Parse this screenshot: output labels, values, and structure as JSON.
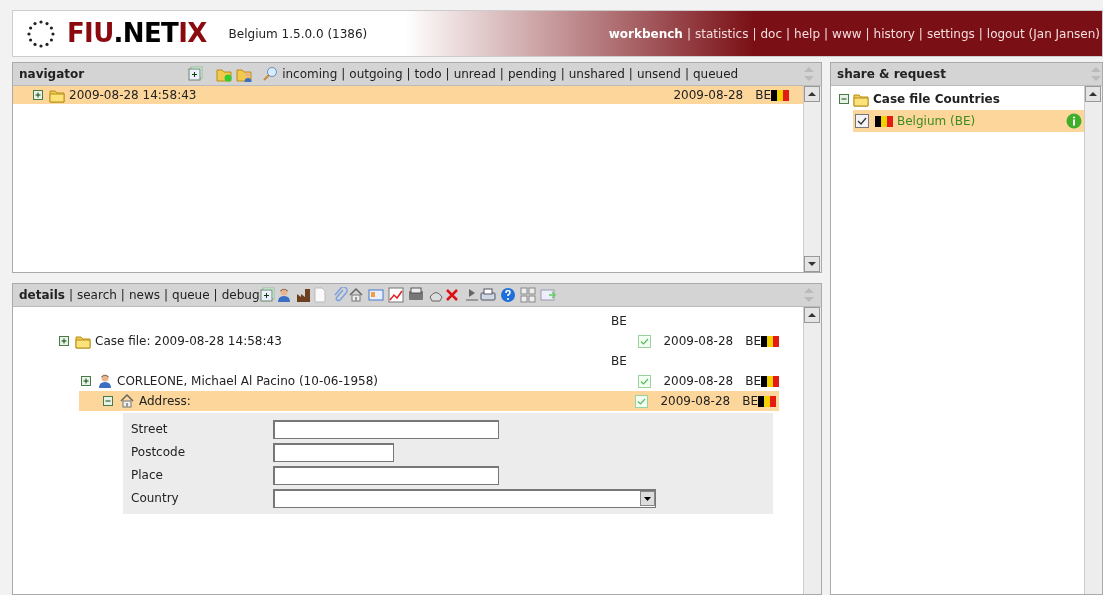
{
  "header": {
    "logo": [
      "FIU",
      ".NET",
      "IX"
    ],
    "version": "Belgium 1.5.0.0 (1386)",
    "separator": "|",
    "nav": [
      {
        "label": "workbench",
        "selected": true
      },
      {
        "label": "statistics",
        "selected": false
      },
      {
        "label": "doc",
        "selected": false
      },
      {
        "label": "help",
        "selected": false
      },
      {
        "label": "www",
        "selected": false
      },
      {
        "label": "history",
        "selected": false
      },
      {
        "label": "settings",
        "selected": false
      },
      {
        "label": "logout (Jan Jansen)",
        "selected": false
      }
    ]
  },
  "navigator": {
    "title": "navigator",
    "separator": "|",
    "filters": [
      "incoming",
      "outgoing",
      "todo",
      "unread",
      "pending",
      "unshared",
      "unsend",
      "queued"
    ],
    "rows": [
      {
        "label": "2009-08-28 14:58:43",
        "expanded": false,
        "selected": true,
        "date": "2009-08-28",
        "country": "BE"
      }
    ]
  },
  "details": {
    "separator": "|",
    "tabs": [
      {
        "label": "details",
        "selected": true
      },
      {
        "label": "search",
        "selected": false
      },
      {
        "label": "news",
        "selected": false
      },
      {
        "label": "queue",
        "selected": false
      },
      {
        "label": "debug",
        "selected": false
      }
    ],
    "tree": [
      {
        "kind": "case",
        "label": "Case file: 2009-08-28 14:58:43",
        "expanded": false,
        "selected": false,
        "note": "BE",
        "checked": true,
        "date": "2009-08-28",
        "country": "BE",
        "children": [
          {
            "kind": "person",
            "label": "CORLEONE, Michael Al Pacino (10-06-1958)",
            "expanded": false,
            "selected": false,
            "note": "BE",
            "checked": true,
            "date": "2009-08-28",
            "country": "BE",
            "children": [
              {
                "kind": "address",
                "label": "Address:",
                "expanded": true,
                "selected": true,
                "checked": true,
                "date": "2009-08-28",
                "country": "BE"
              }
            ]
          }
        ]
      }
    ],
    "form": [
      {
        "label": "Street",
        "kind": "long"
      },
      {
        "label": "Postcode",
        "kind": "short"
      },
      {
        "label": "Place",
        "kind": "long"
      },
      {
        "label": "Country",
        "kind": "select"
      }
    ]
  },
  "share": {
    "title": "share & request",
    "tree": [
      {
        "label": "Case file Countries",
        "expanded": true,
        "children": [
          {
            "label": "Belgium (BE)",
            "checked": true,
            "selected": true
          }
        ]
      }
    ]
  }
}
